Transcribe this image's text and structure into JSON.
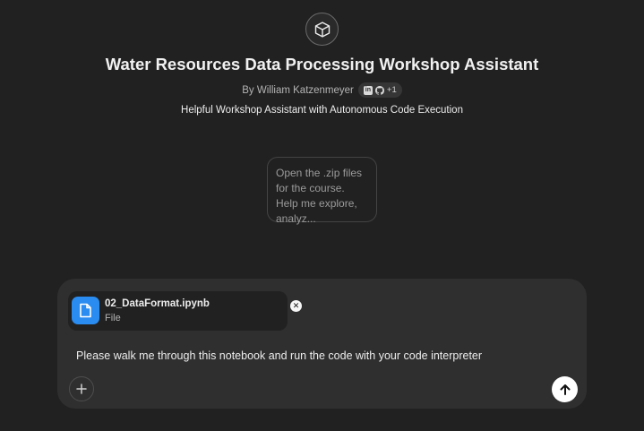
{
  "header": {
    "icon": "cube-icon",
    "title": "Water Resources Data Processing Workshop Assistant",
    "byline": "By William Katzenmeyer",
    "social_badge": {
      "icons": [
        "linkedin-icon",
        "github-icon"
      ],
      "extra_count": "+1"
    },
    "description": "Helpful Workshop Assistant with Autonomous Code Execution"
  },
  "starters": [
    {
      "text": "Open the .zip files for the course. Help me explore, analyz..."
    }
  ],
  "composer": {
    "attachment": {
      "name": "02_DataFormat.ipynb",
      "type": "File",
      "icon": "file-icon",
      "remove_icon": "close-icon"
    },
    "input_value": "Please walk me through this notebook and run the code with your code interpreter",
    "attach_icon": "plus-icon",
    "send_icon": "arrow-up-icon"
  },
  "colors": {
    "background": "#212121",
    "composer": "#2f2f2f",
    "file_icon": "#2a8cf0",
    "send_button": "#ffffff"
  }
}
